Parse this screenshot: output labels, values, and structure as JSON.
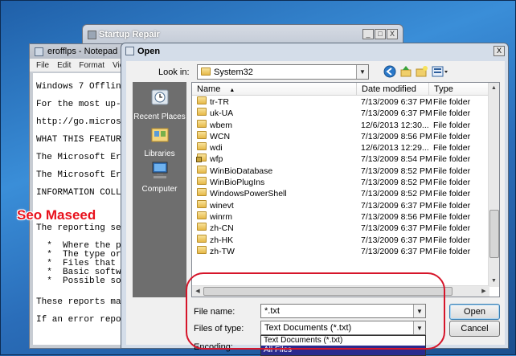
{
  "startup_repair": {
    "title": "Startup Repair",
    "btn_min": "_",
    "btn_max": "□",
    "btn_close": "X"
  },
  "notepad": {
    "title": "erofflps - Notepad",
    "menu": [
      "File",
      "Edit",
      "Format",
      "View"
    ],
    "lines": [
      "Windows 7 Offlin",
      "For the most up-",
      "http://go.micros",
      "WHAT THIS FEATUR",
      "The Microsoft Er",
      "The Microsoft Er",
      "INFORMATION COLL",
      "The reporting se",
      "  *  Where the p",
      "  *  The type or",
      "  *  Files that ",
      "  *  Basic softw",
      "  *  Possible so",
      "These reports ma",
      "If an error repo"
    ]
  },
  "watermark": "Seo Maseed",
  "open_dialog": {
    "title": "Open",
    "close": "X",
    "look_in_label": "Look in:",
    "look_in_value": "System32",
    "places": [
      {
        "label": "Recent Places",
        "icon": "recent-places-icon"
      },
      {
        "label": "Libraries",
        "icon": "libraries-icon"
      },
      {
        "label": "Computer",
        "icon": "computer-icon"
      }
    ],
    "columns": [
      "Name",
      "Date modified",
      "Type"
    ],
    "files": [
      {
        "name": "tr-TR",
        "date": "7/13/2009 6:37 PM",
        "type": "File folder"
      },
      {
        "name": "uk-UA",
        "date": "7/13/2009 6:37 PM",
        "type": "File folder"
      },
      {
        "name": "wbem",
        "date": "12/6/2013 12:30...",
        "type": "File folder"
      },
      {
        "name": "WCN",
        "date": "7/13/2009 8:56 PM",
        "type": "File folder"
      },
      {
        "name": "wdi",
        "date": "12/6/2013 12:29...",
        "type": "File folder"
      },
      {
        "name": "wfp",
        "date": "7/13/2009 8:54 PM",
        "type": "File folder"
      },
      {
        "name": "WinBioDatabase",
        "date": "7/13/2009 8:52 PM",
        "type": "File folder"
      },
      {
        "name": "WinBioPlugIns",
        "date": "7/13/2009 8:52 PM",
        "type": "File folder"
      },
      {
        "name": "WindowsPowerShell",
        "date": "7/13/2009 8:52 PM",
        "type": "File folder"
      },
      {
        "name": "winevt",
        "date": "7/13/2009 6:37 PM",
        "type": "File folder"
      },
      {
        "name": "winrm",
        "date": "7/13/2009 8:56 PM",
        "type": "File folder"
      },
      {
        "name": "zh-CN",
        "date": "7/13/2009 6:37 PM",
        "type": "File folder"
      },
      {
        "name": "zh-HK",
        "date": "7/13/2009 6:37 PM",
        "type": "File folder"
      },
      {
        "name": "zh-TW",
        "date": "7/13/2009 6:37 PM",
        "type": "File folder"
      }
    ],
    "file_name_label": "File name:",
    "file_name_value": "*.txt",
    "files_of_type_label": "Files of type:",
    "files_of_type_value": "Text Documents (*.txt)",
    "encoding_label": "Encoding:",
    "type_options": [
      "Text Documents (*.txt)",
      "All Files"
    ],
    "selected_option": "All Files",
    "open_button": "Open",
    "cancel_button": "Cancel"
  }
}
